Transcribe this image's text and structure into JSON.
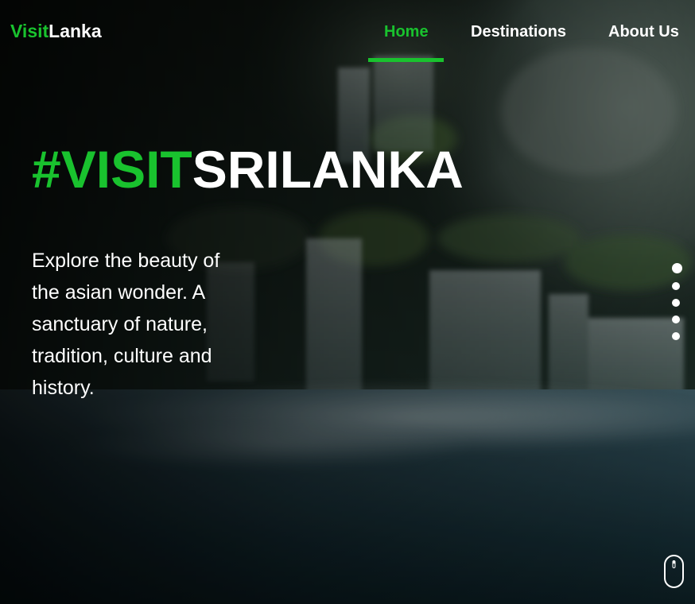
{
  "logo": {
    "accent": "Visit",
    "rest": "Lanka"
  },
  "nav": {
    "items": [
      {
        "label": "Home",
        "active": true
      },
      {
        "label": "Destinations",
        "active": false
      },
      {
        "label": "About Us",
        "active": false
      }
    ]
  },
  "hero": {
    "headline_accent": "#VISIT",
    "headline_rest": "SRILANKA",
    "tagline": "Explore the beauty of the asian wonder. A sanctuary of nature, tradition, culture and history."
  },
  "slider": {
    "slide_count": 5,
    "active_index": 0
  },
  "icons": {
    "scroll": "mouse-scroll-icon"
  },
  "colors": {
    "accent": "#19c22e",
    "text": "#ffffff",
    "background": "#0b1416"
  }
}
